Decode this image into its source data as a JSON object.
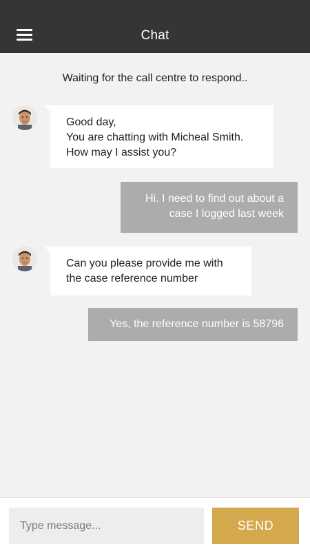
{
  "header": {
    "title": "Chat",
    "menu_icon": "hamburger-menu-icon",
    "background": "#363533"
  },
  "status": "Waiting for the call centre to respond..",
  "messages": [
    {
      "sender": "agent",
      "avatar": "agent-avatar",
      "lines": [
        "Good day,",
        "You are chatting with Micheal Smith.",
        "How may I assist you?"
      ]
    },
    {
      "sender": "user",
      "lines": [
        "Hi. I need to find out about a",
        "case I logged last week"
      ]
    },
    {
      "sender": "agent",
      "avatar": "agent-avatar",
      "lines": [
        "Can you please provide me with",
        "the case reference number"
      ]
    },
    {
      "sender": "user",
      "lines": [
        "Yes, the reference number is 58796"
      ]
    }
  ],
  "composer": {
    "placeholder": "Type message...",
    "value": "",
    "send_label": "SEND",
    "send_color": "#d4a94d"
  },
  "colors": {
    "background": "#f2f2f2",
    "agent_bubble": "#ffffff",
    "user_bubble": "#acacac"
  }
}
